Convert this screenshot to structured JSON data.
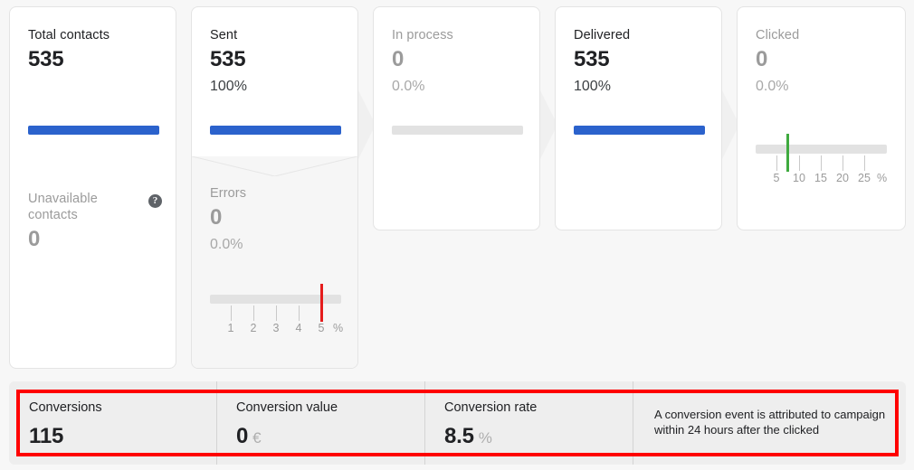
{
  "funnel": {
    "cards": [
      {
        "id": "total-contacts",
        "title": "Total contacts",
        "value": "535",
        "percent": null,
        "bar": {
          "kind": "blue",
          "fill_pct": 100
        },
        "dimmed": false,
        "lower": {
          "title": "Unavailable\ncontacts",
          "title_line1": "Unavailable",
          "title_line2": "contacts",
          "value": "0",
          "percent": null,
          "help_icon": "help-circle-icon",
          "scale": null
        }
      },
      {
        "id": "sent",
        "title": "Sent",
        "value": "535",
        "percent": "100%",
        "bar": {
          "kind": "blue",
          "fill_pct": 100
        },
        "dimmed": false,
        "lower": {
          "title_line1": "Errors",
          "title_line2": "",
          "value": "0",
          "percent": "0.0%",
          "help_icon": null,
          "scale": {
            "ticks": [
              "1",
              "2",
              "3",
              "4",
              "5"
            ],
            "unit": "%",
            "marker_color": "#e51c1c",
            "marker_at_tick": 5,
            "marker_value": 5
          }
        }
      },
      {
        "id": "in-process",
        "title": "In process",
        "value": "0",
        "percent": "0.0%",
        "bar": {
          "kind": "grey",
          "fill_pct": 100
        },
        "dimmed": true,
        "lower": null
      },
      {
        "id": "delivered",
        "title": "Delivered",
        "value": "535",
        "percent": "100%",
        "bar": {
          "kind": "blue",
          "fill_pct": 100
        },
        "dimmed": false,
        "lower": null
      },
      {
        "id": "clicked",
        "title": "Clicked",
        "value": "0",
        "percent": "0.0%",
        "bar": null,
        "dimmed": true,
        "scale": {
          "ticks": [
            "5",
            "10",
            "15",
            "20",
            "25"
          ],
          "unit": "%",
          "marker_color": "#3faa3f",
          "marker_value": 7
        },
        "lower": null
      }
    ]
  },
  "conversions": {
    "columns": [
      {
        "id": "conversions",
        "label": "Conversions",
        "value": "115",
        "unit": ""
      },
      {
        "id": "conversion-value",
        "label": "Conversion value",
        "value": "0",
        "unit": "€"
      },
      {
        "id": "conversion-rate",
        "label": "Conversion rate",
        "value": "8.5",
        "unit": "%"
      }
    ],
    "note": "A conversion event is attributed to campaign within 24 hours after the clicked"
  },
  "colors": {
    "accent_blue": "#2b62cc",
    "track_grey": "#e2e2e2",
    "error_red": "#e51c1c",
    "benchmark_green": "#3faa3f",
    "highlight_red": "#ff0000",
    "page_bg": "#f7f7f7",
    "panel_bg": "#eeeeee"
  }
}
